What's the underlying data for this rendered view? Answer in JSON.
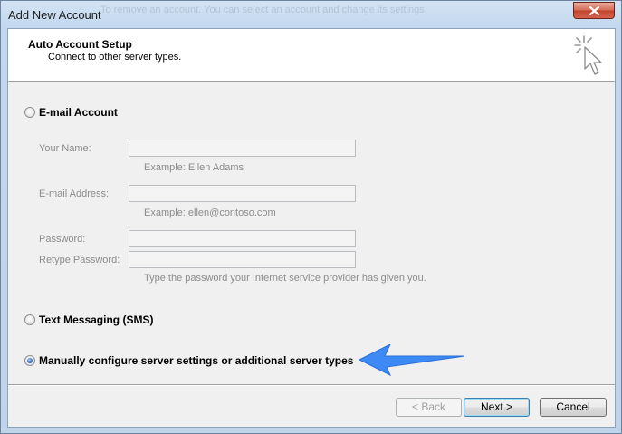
{
  "window": {
    "title": "Add New Account",
    "ghost_text": "To remove an account. You can select an account and change its settings."
  },
  "header": {
    "title": "Auto Account Setup",
    "subtitle": "Connect to other server types."
  },
  "options": {
    "email_account": {
      "label": "E-mail Account",
      "selected": false
    },
    "sms": {
      "label": "Text Messaging (SMS)",
      "selected": false
    },
    "manual": {
      "label": "Manually configure server settings or additional server types",
      "selected": true
    }
  },
  "fields": {
    "your_name": {
      "label": "Your Name:",
      "value": "",
      "example": "Example: Ellen Adams"
    },
    "email_address": {
      "label": "E-mail Address:",
      "value": "",
      "example": "Example: ellen@contoso.com"
    },
    "password": {
      "label": "Password:",
      "value": ""
    },
    "retype_password": {
      "label": "Retype Password:",
      "value": ""
    },
    "password_hint": "Type the password your Internet service provider has given you."
  },
  "buttons": {
    "back": "< Back",
    "next": "Next >",
    "cancel": "Cancel"
  },
  "colors": {
    "annotation_arrow": "#3d8af7",
    "title_bar": "#c3d7ee",
    "client_bg": "#f0f0f0"
  },
  "icons": {
    "close": "close-icon",
    "wizard": "cursor-sparkle-icon",
    "annotation": "blue-arrow-icon"
  }
}
